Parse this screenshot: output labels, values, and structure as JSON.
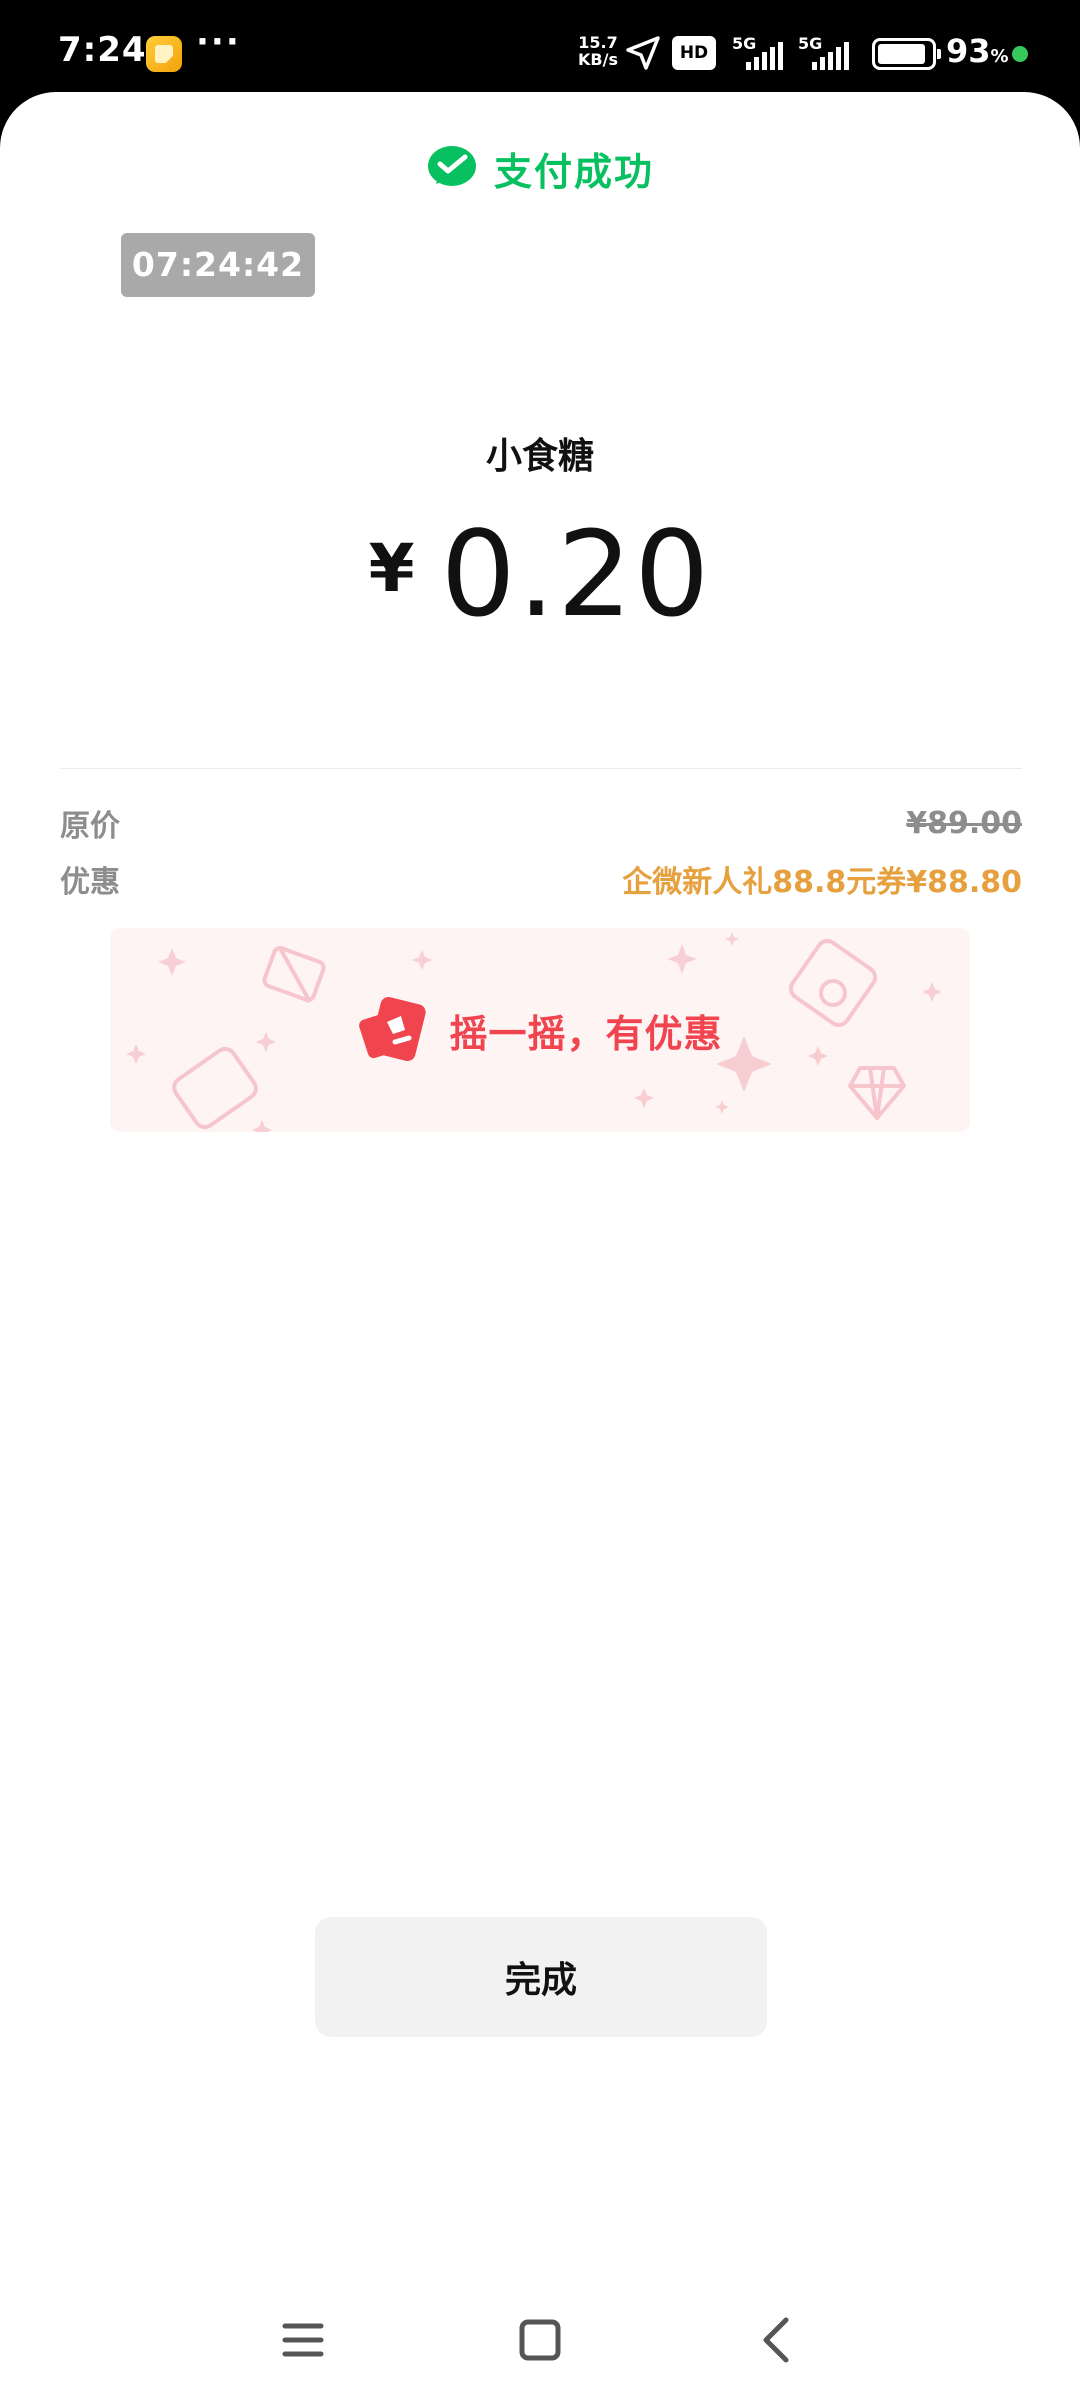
{
  "status_bar": {
    "time": "7:24",
    "more": "···",
    "speed_value": "15.7",
    "speed_unit": "KB/s",
    "hd_label": "HD",
    "network_1": "5G",
    "network_2": "5G",
    "battery_percent": "93",
    "battery_unit": "%",
    "battery_level": 0.93,
    "dot_color": "#36c95b"
  },
  "header": {
    "title": "支付成功",
    "icon": "wechat-pay-icon",
    "accent_color": "#07c160"
  },
  "time_badge": "07:24:42",
  "payment": {
    "merchant": "小食糖",
    "currency_symbol": "¥",
    "amount": "0.20"
  },
  "details": {
    "original_label": "原价",
    "original_value": "¥89.00",
    "discount_label": "优惠",
    "discount_value": "企微新人礼88.8元券¥88.80",
    "discount_color": "#e6a03e"
  },
  "promo": {
    "text": "摇一摇，有优惠",
    "icon": "shake-icon",
    "text_color": "#f0444f"
  },
  "done_button": "完成",
  "nav": {
    "menu_icon": "menu-icon",
    "home_icon": "home-icon",
    "back_icon": "back-icon"
  }
}
